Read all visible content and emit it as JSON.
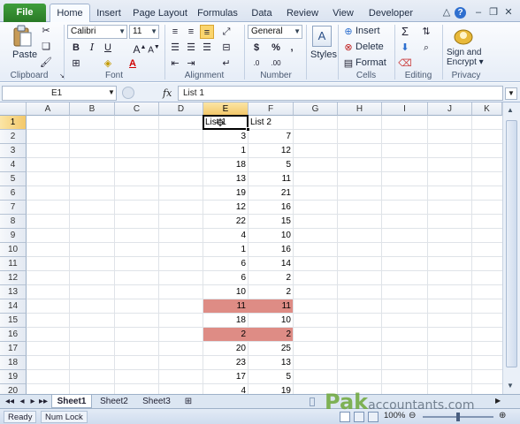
{
  "tabs": [
    "File",
    "Home",
    "Insert",
    "Page Layout",
    "Formulas",
    "Data",
    "Review",
    "View",
    "Developer"
  ],
  "ribbon": {
    "clipboard": {
      "paste_label": "Paste",
      "group_label": "Clipboard"
    },
    "font": {
      "font_name": "Calibri",
      "font_size": "11",
      "group_label": "Font"
    },
    "alignment": {
      "group_label": "Alignment"
    },
    "number": {
      "format": "General",
      "currency_symbol": "$",
      "percent": "%",
      "comma": ",",
      "group_label": "Number"
    },
    "styles": {
      "label": "Styles"
    },
    "cells": {
      "insert": "Insert",
      "delete": "Delete",
      "format": "Format",
      "group_label": "Cells"
    },
    "editing": {
      "group_label": "Editing"
    },
    "privacy": {
      "sign_label": "Sign and",
      "encrypt_label": "Encrypt",
      "group_label": "Privacy"
    }
  },
  "formula_bar": {
    "name_box": "E1",
    "fx": "fx",
    "content": "List 1"
  },
  "columns": [
    "A",
    "B",
    "C",
    "D",
    "E",
    "F",
    "G",
    "H",
    "I",
    "J",
    "K"
  ],
  "rows": [
    "1",
    "2",
    "3",
    "4",
    "5",
    "6",
    "7",
    "8",
    "9",
    "10",
    "11",
    "12",
    "13",
    "14",
    "15",
    "16",
    "17",
    "18",
    "19",
    "20"
  ],
  "headers": {
    "e": "List 1",
    "f": "List 2"
  },
  "list1": [
    "3",
    "1",
    "18",
    "13",
    "19",
    "12",
    "22",
    "4",
    "1",
    "6",
    "6",
    "10",
    "11",
    "18",
    "2",
    "20",
    "23",
    "17",
    "4"
  ],
  "list2": [
    "7",
    "12",
    "5",
    "11",
    "21",
    "16",
    "15",
    "10",
    "16",
    "14",
    "2",
    "2",
    "11",
    "10",
    "2",
    "25",
    "13",
    "5",
    "19"
  ],
  "highlight_color": "#de8c85",
  "sheets": [
    "Sheet1",
    "Sheet2",
    "Sheet3"
  ],
  "status": {
    "ready": "Ready",
    "numlock": "Num Lock",
    "zoom": "100%"
  },
  "watermark": {
    "main": "Pak",
    "rest": "accountants.com"
  }
}
